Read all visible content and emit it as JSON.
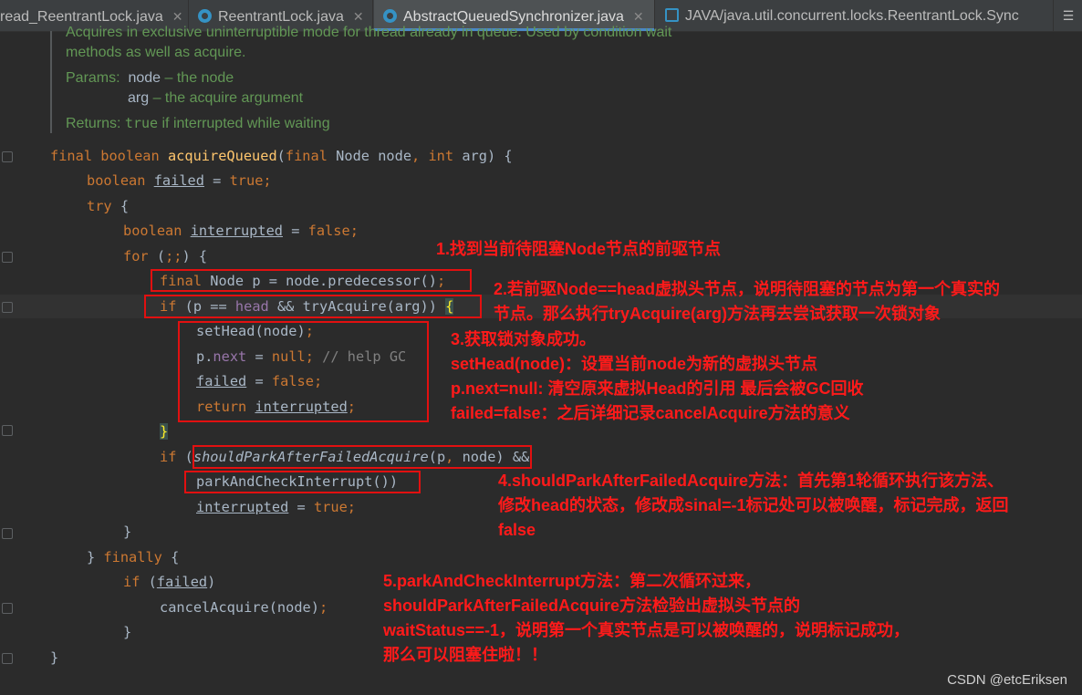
{
  "tabs": [
    {
      "label": "read_ReentrantLock.java"
    },
    {
      "label": "ReentrantLock.java"
    },
    {
      "label": "AbstractQueuedSynchronizer.java"
    },
    {
      "label": "JAVA/java.util.concurrent.locks.ReentrantLock.Sync"
    }
  ],
  "doc": {
    "line1": "Acquires in exclusive uninterruptible mode for thread already in queue. Used by condition wait",
    "line2": "methods as well as acquire.",
    "params_label": "Params:",
    "param1_name": "node",
    "param1_desc": " – the node",
    "param2_name": "arg",
    "param2_desc": " – the acquire argument",
    "returns_label": "Returns:",
    "returns_true": "true",
    "returns_desc": " if interrupted while waiting"
  },
  "annotations": {
    "note1": "1.找到当前待阻塞Node节点的前驱节点",
    "note2": "2.若前驱Node==head虚拟头节点，说明待阻塞的节点为第一个真实的\n节点。那么执行tryAcquire(arg)方法再去尝试获取一次锁对象",
    "note3": "3.获取锁对象成功。\nsetHead(node)：设置当前node为新的虚拟头节点\np.next=null: 清空原来虚拟Head的引用 最后会被GC回收\nfailed=false：之后详细记录cancelAcquire方法的意义",
    "note4": "4.shouldParkAfterFailedAcquire方法：首先第1轮循环执行该方法、\n修改head的状态，修改成sinal=-1标记处可以被唤醒，标记完成，返回\nfalse",
    "note5": "5.parkAndCheckInterrupt方法：第二次循环过来，\nshouldParkAfterFailedAcquire方法检验出虚拟头节点的\nwaitStatus==-1，说明第一个真实节点是可以被唤醒的，说明标记成功，\n那么可以阻塞住啦！！"
  },
  "watermark": "CSDN @etcEriksen",
  "colors": {
    "keyword": "#cc7832",
    "method": "#ffc66d",
    "field": "#9876aa",
    "comment": "#808080",
    "annotation": "#e21010"
  }
}
